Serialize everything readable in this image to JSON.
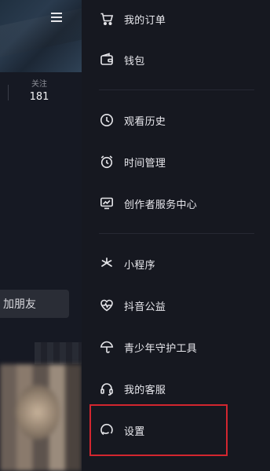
{
  "profile": {
    "stats": {
      "label": "关注",
      "value": "181"
    },
    "add_friend_label": "加朋友"
  },
  "drawer": {
    "items": [
      {
        "label": "我的订单",
        "icon": "cart-icon"
      },
      {
        "label": "钱包",
        "icon": "wallet-icon"
      },
      {
        "label": "观看历史",
        "icon": "clock-icon"
      },
      {
        "label": "时间管理",
        "icon": "alarm-clock-icon"
      },
      {
        "label": "创作者服务中心",
        "icon": "monitor-chart-icon"
      },
      {
        "label": "小程序",
        "icon": "asterisk-icon"
      },
      {
        "label": "抖音公益",
        "icon": "heart-pulse-icon"
      },
      {
        "label": "青少年守护工具",
        "icon": "umbrella-icon"
      },
      {
        "label": "我的客服",
        "icon": "headset-icon"
      },
      {
        "label": "设置",
        "icon": "settings-icon"
      }
    ]
  },
  "colors": {
    "highlight": "#d3262f",
    "background": "#15171f"
  }
}
